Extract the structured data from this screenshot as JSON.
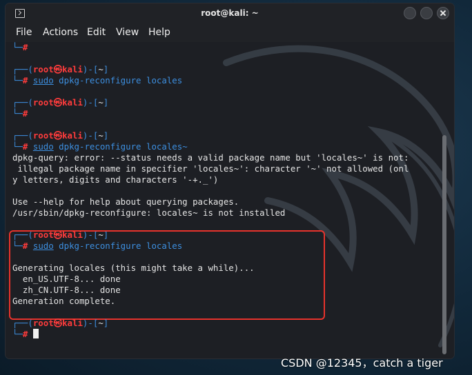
{
  "window": {
    "title": "root@kali: ~"
  },
  "menu": [
    "File",
    "Actions",
    "Edit",
    "View",
    "Help"
  ],
  "prompt": {
    "user": "root",
    "host": "kali",
    "skull": "㉿",
    "dir": "~",
    "symbol": "#",
    "top_left": "┌──(",
    "mid": ")-[",
    "end": "]",
    "bottom_left": "└─"
  },
  "terminal": {
    "cmd_sudo": "sudo",
    "cmd1_rest": " dpkg-reconfigure locales",
    "cmd2_rest": " dpkg-reconfigure locales~",
    "err1": "dpkg-query: error: --status needs a valid package name but 'locales~' is not:",
    "err2": " illegal package name in specifier 'locales~': character '~' not allowed (onl",
    "err3": "y letters, digits and characters '-+._')",
    "help1": "Use --help for help about querying packages.",
    "help2": "/usr/sbin/dpkg-reconfigure: locales~ is not installed",
    "gen1": "Generating locales (this might take a while)...",
    "gen2": "  en_US.UTF-8... done",
    "gen3": "  zh_CN.UTF-8... done",
    "gen4": "Generation complete."
  },
  "watermark": "CSDN @12345，catch a tiger"
}
